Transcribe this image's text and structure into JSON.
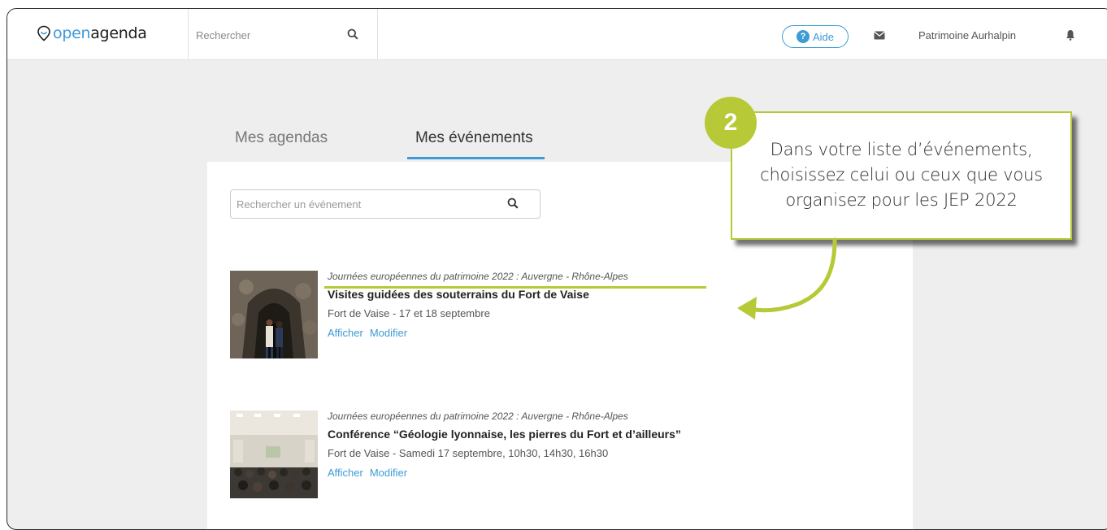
{
  "header": {
    "logo_open": "open",
    "logo_agenda": "agenda",
    "search_placeholder": "Rechercher",
    "help_label": "Aide",
    "user_name": "Patrimoine Aurhalpin",
    "icons": [
      "pin-icon",
      "search-icon",
      "help-icon",
      "mail-icon",
      "bell-icon"
    ]
  },
  "tabs": [
    {
      "label": "Mes agendas",
      "active": false
    },
    {
      "label": "Mes événements",
      "active": true
    }
  ],
  "event_search": {
    "placeholder": "Rechercher un événement"
  },
  "events": [
    {
      "agenda": "Journées européennes du patrimoine 2022 : Auvergne - Rhône-Alpes",
      "title": "Visites guidées des souterrains du Fort de Vaise",
      "meta": "Fort de Vaise - 17 et 18 septembre",
      "view_label": "Afficher",
      "edit_label": "Modifier"
    },
    {
      "agenda": "Journées européennes du patrimoine 2022 : Auvergne - Rhône-Alpes",
      "title": "Conférence “Géologie lyonnaise, les pierres du Fort et d’ailleurs”",
      "meta": "Fort de Vaise - Samedi 17 septembre, 10h30, 14h30, 16h30",
      "view_label": "Afficher",
      "edit_label": "Modifier"
    }
  ],
  "callout": {
    "step": "2",
    "line1": "Dans votre liste d’événements,",
    "line2": "choisissez celui ou ceux que vous",
    "line3": "organisez pour les JEP 2022"
  },
  "colors": {
    "accent_blue": "#3d9bd6",
    "accent_green": "#b7c936",
    "background": "#eeeeee"
  }
}
